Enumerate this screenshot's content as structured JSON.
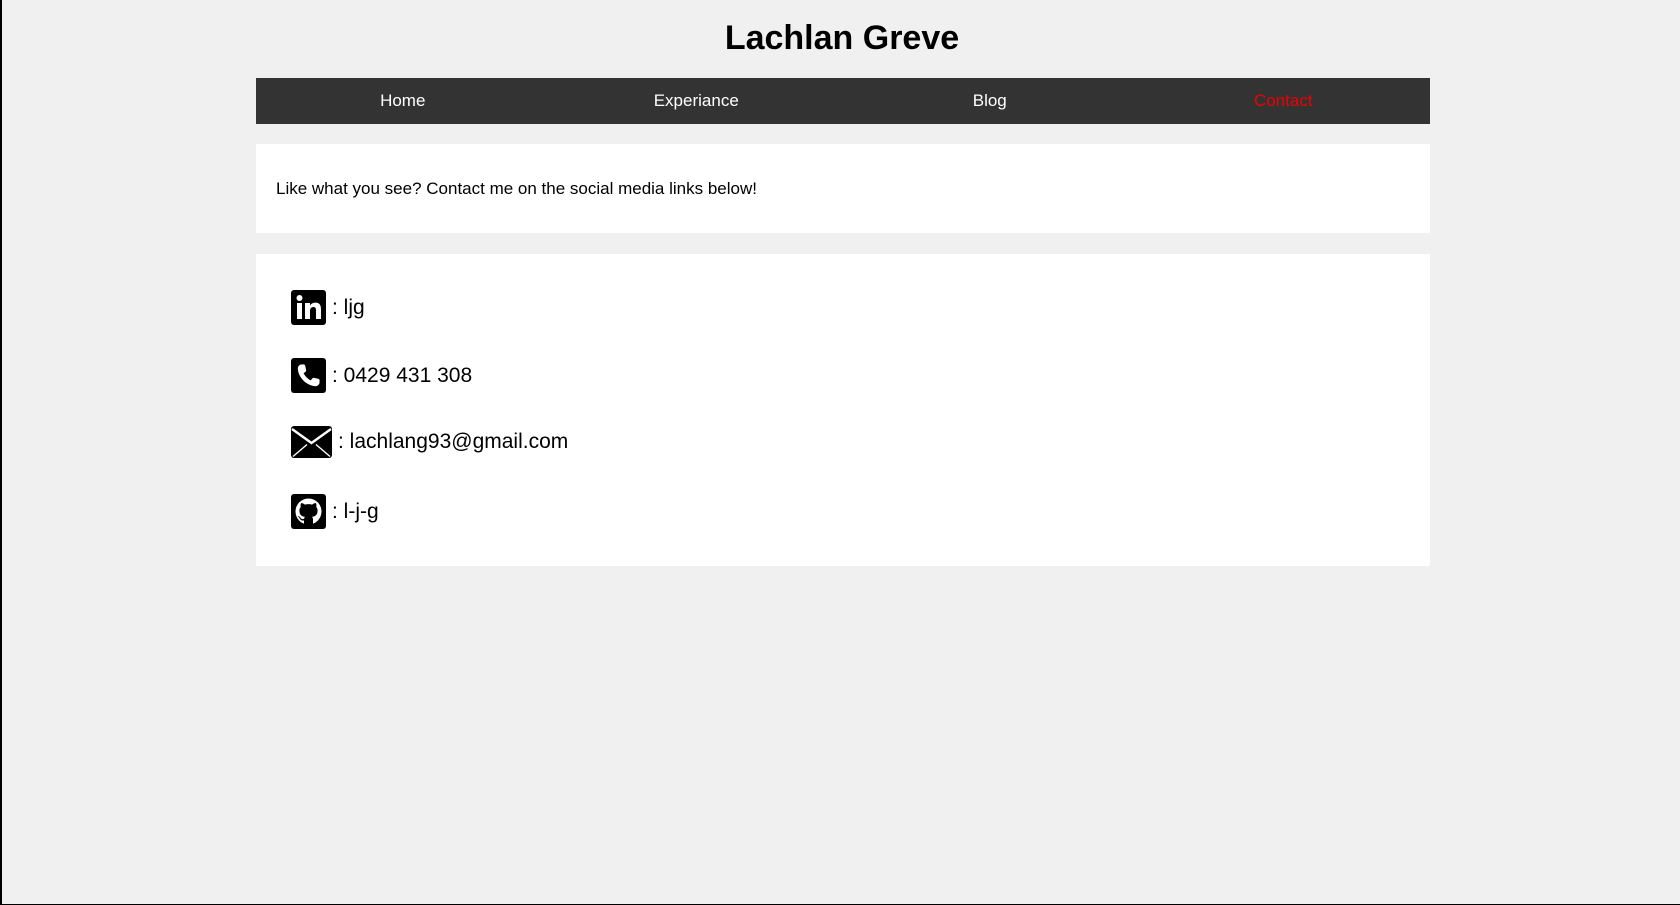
{
  "header": {
    "title": "Lachlan Greve"
  },
  "nav": {
    "items": [
      {
        "label": "Home",
        "active": false
      },
      {
        "label": "Experiance",
        "active": false
      },
      {
        "label": "Blog",
        "active": false
      },
      {
        "label": "Contact",
        "active": true
      }
    ],
    "background_color": "#333333",
    "active_color": "#ee0000"
  },
  "intro": {
    "text": "Like what you see? Contact me on the social media links below!"
  },
  "contacts": [
    {
      "icon": "linkedin-icon",
      "text": ": ljg"
    },
    {
      "icon": "phone-icon",
      "text": ": 0429 431 308"
    },
    {
      "icon": "email-icon",
      "text": ": lachlang93@gmail.com"
    },
    {
      "icon": "github-icon",
      "text": ": l-j-g"
    }
  ]
}
